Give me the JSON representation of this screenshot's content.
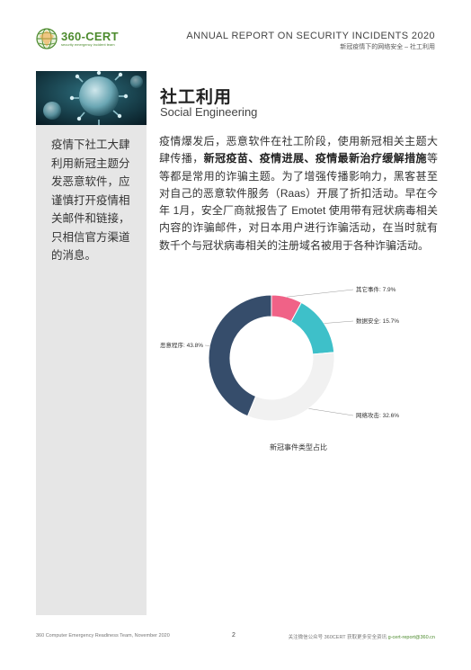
{
  "header": {
    "logo_name": "360-CERT",
    "logo_tagline": "security emergency incident team",
    "report_title": "ANNUAL REPORT ON SECURITY INCIDENTS 2020",
    "report_subtitle": "新冠疫情下的网络安全 – 社工利用"
  },
  "sidebar": {
    "text": "疫情下社工大肆利用新冠主题分发恶意软件，应谨慎打开疫情相关邮件和链接，只相信官方渠道的消息。"
  },
  "section": {
    "title_cn": "社工利用",
    "title_en": "Social Engineering"
  },
  "body": {
    "part1": "疫情爆发后，恶意软件在社工阶段，使用新冠相关主题大肆传播，",
    "bold": "新冠疫苗、疫情进展、疫情最新治疗缓解措施",
    "part2": "等等都是常用的诈骗主题。为了增强传播影响力，黑客甚至对自己的恶意软件服务（Raas）开展了折扣活动。早在今年 1月，安全厂商就报告了 Emotet 使用带有冠状病毒相关内容的诈骗邮件，对日本用户进行诈骗活动，在当时就有数千个与冠状病毒相关的注册域名被用于各种诈骗活动。"
  },
  "chart_data": {
    "type": "pie",
    "title": "新冠事件类型占比",
    "series": [
      {
        "name": "其它事件",
        "value": 7.9,
        "label": "其它事件: 7.9%",
        "color": "#f06287"
      },
      {
        "name": "数据安全",
        "value": 15.7,
        "label": "数据安全: 15.7%",
        "color": "#3ec0c9"
      },
      {
        "name": "网络攻击",
        "value": 32.6,
        "label": "网络攻击: 32.6%",
        "color": "#f1f1f1"
      },
      {
        "name": "恶意程序",
        "value": 43.8,
        "label": "恶意程序: 43.8%",
        "color": "#364d6b"
      }
    ]
  },
  "footer": {
    "left": "360 Computer Emergency Readiness Team, November 2020",
    "page": "2",
    "right": "关注微信公众号 360CERT 获取更多安全资讯",
    "email": "g-cert-report@360.cn"
  }
}
